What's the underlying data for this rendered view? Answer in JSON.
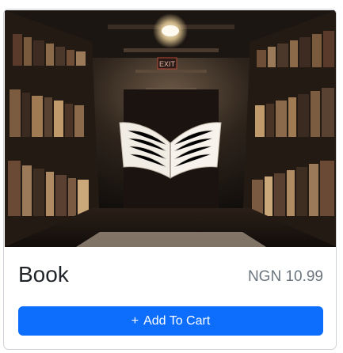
{
  "product": {
    "image_alt": "Open book floating in a library aisle",
    "title": "Book",
    "price": "NGN 10.99",
    "add_button": {
      "icon": "plus-icon",
      "icon_glyph": "+",
      "label": "Add To Cart"
    }
  },
  "colors": {
    "primary": "#0d6efd",
    "price_text": "#6c757d",
    "title_text": "#212529",
    "card_border": "#cfd3d7"
  }
}
